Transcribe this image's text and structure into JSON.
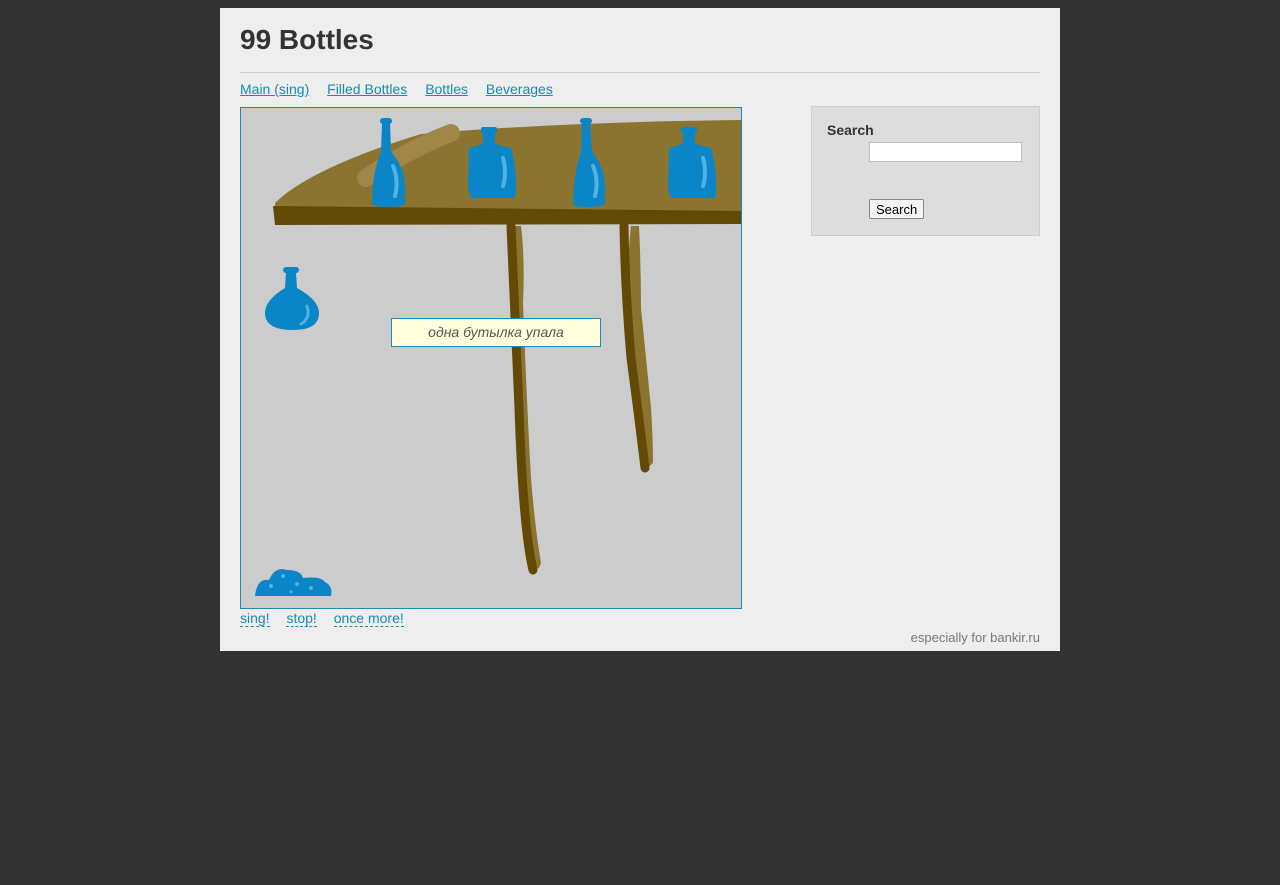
{
  "header": {
    "title": "99 Bottles"
  },
  "nav": {
    "items": [
      {
        "label": "Main (sing)"
      },
      {
        "label": "Filled Bottles"
      },
      {
        "label": "Bottles"
      },
      {
        "label": "Beverages"
      }
    ]
  },
  "stage": {
    "message": "одна бутылка упала"
  },
  "controls": {
    "sing": "sing!",
    "stop": "stop!",
    "again": "once more!"
  },
  "sidebar": {
    "title": "Search",
    "search_placeholder": "",
    "search_button": "Search"
  },
  "footer": {
    "text": "especially for bankir.ru"
  },
  "colors": {
    "background": "#333333",
    "page": "#eeeeee",
    "link": "#1a8bb3",
    "shelf": "#8b7330",
    "shelf_dark": "#624a06",
    "bottle": "#0a86c8"
  }
}
